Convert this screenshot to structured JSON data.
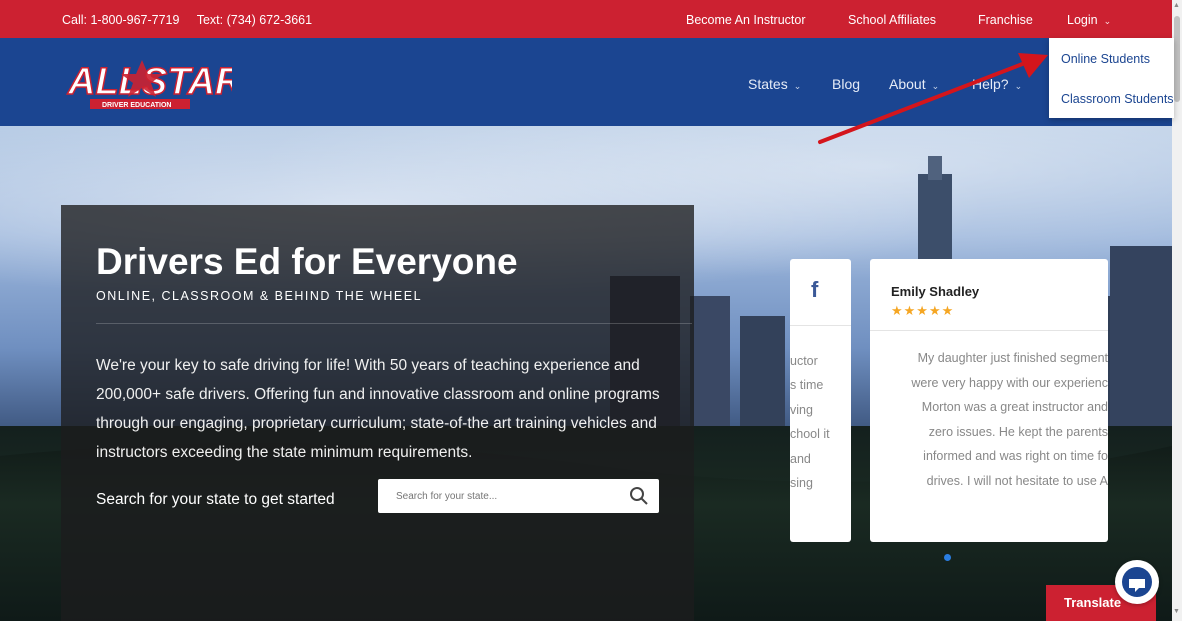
{
  "topbar": {
    "call": "Call: 1-800-967-7719",
    "text": "Text: (734) 672-3661",
    "links": {
      "become_instructor": "Become An Instructor",
      "school_affiliates": "School Affiliates",
      "franchise": "Franchise",
      "login": "Login"
    }
  },
  "logo": {
    "brand": "ALLSTAR",
    "tagline": "DRIVER EDUCATION"
  },
  "nav": {
    "states": "States",
    "blog": "Blog",
    "about": "About",
    "help": "Help?"
  },
  "login_dropdown": {
    "online_students": "Online Students",
    "classroom_students": "Classroom Students"
  },
  "hero": {
    "title": "Drivers Ed for Everyone",
    "subtitle": "ONLINE, CLASSROOM & BEHIND THE WHEEL",
    "description": "We're your key to safe driving for life! With 50 years of teaching experience and 200,000+ safe drivers. Offering fun and innovative classroom and online programs through our engaging, proprietary curriculum; state-of-the art training vehicles and instructors exceeding the state minimum requirements.",
    "search_label": "Search for your state to get started",
    "search_placeholder": "Search for your state..."
  },
  "reviews": {
    "facebook_card": {
      "icon": "facebook-icon",
      "fragments": [
        "uctor",
        "s time",
        "ving",
        "chool it",
        "and",
        "sing"
      ]
    },
    "review_card": {
      "name": "Emily Shadley",
      "stars": "★★★★★",
      "rating": 5,
      "lines": [
        "My daughter just finished segment",
        "were very happy with our experienc",
        "Morton was a great instructor and",
        "zero issues. He kept the parents",
        "informed and was right on time fo",
        "drives. I will not hesitate to use A"
      ]
    }
  },
  "translate": {
    "label": "Translate"
  },
  "colors": {
    "topbar_red": "#cc2131",
    "header_blue": "#1b4591",
    "star_gold": "#f5a623",
    "facebook_blue": "#3b5998"
  }
}
